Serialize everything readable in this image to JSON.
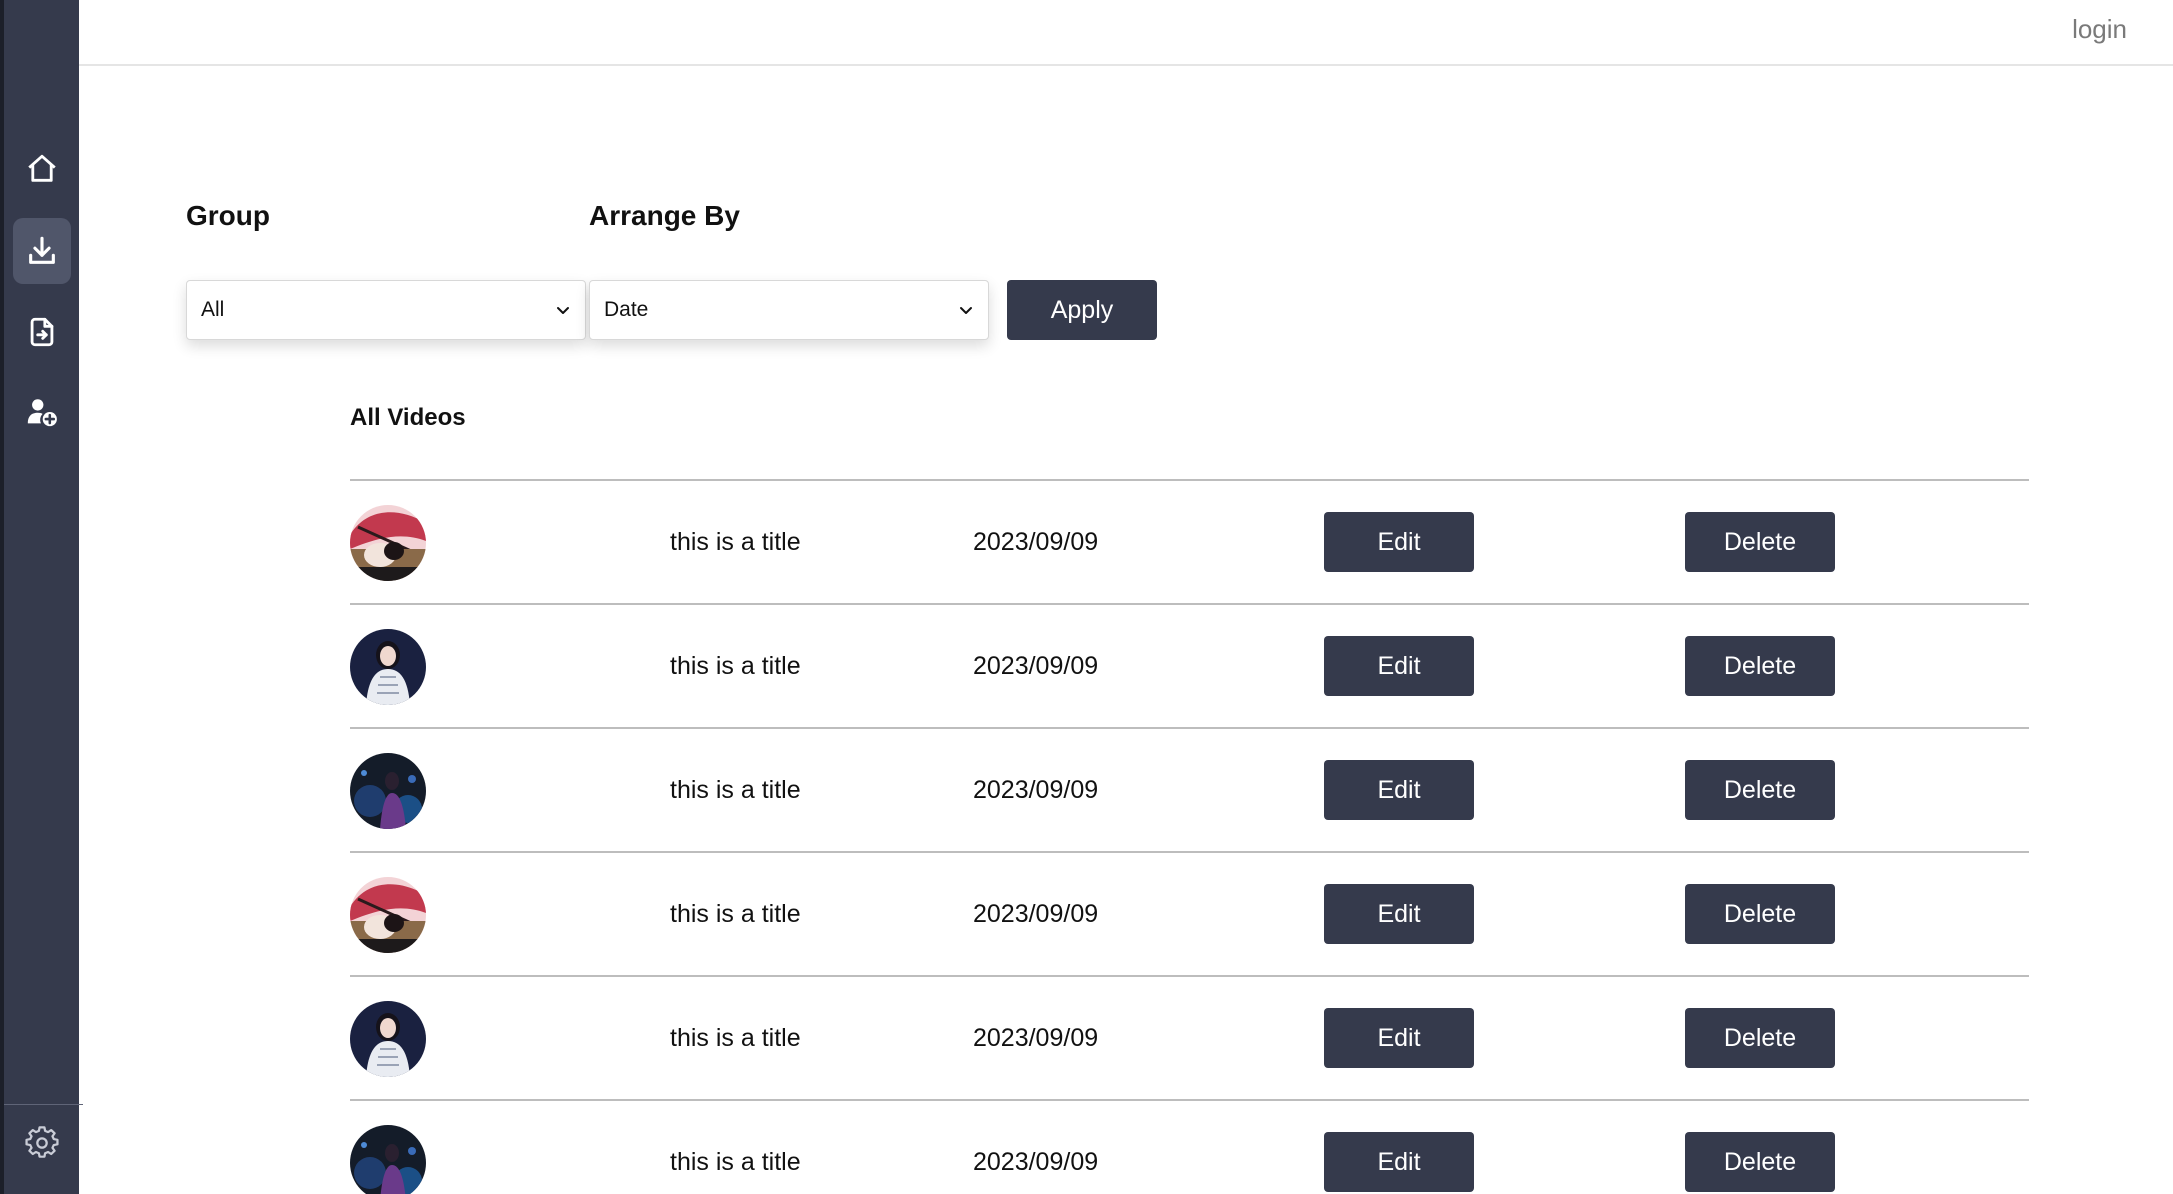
{
  "topbar": {
    "login_label": "login"
  },
  "sidebar": {
    "items": [
      {
        "icon": "home-icon"
      },
      {
        "icon": "download-icon",
        "active": true
      },
      {
        "icon": "file-import-icon"
      },
      {
        "icon": "add-user-icon"
      }
    ],
    "footer_icon": "gear-icon"
  },
  "filters": {
    "group_label": "Group",
    "group_value": "All",
    "arrange_label": "Arrange By",
    "arrange_value": "Date",
    "apply_label": "Apply"
  },
  "videos": {
    "heading": "All Videos",
    "edit_label": "Edit",
    "delete_label": "Delete",
    "rows": [
      {
        "title": "this is a title",
        "date": "2023/09/09",
        "thumb": "pink-umbrella"
      },
      {
        "title": "this is a title",
        "date": "2023/09/09",
        "thumb": "white-dress"
      },
      {
        "title": "this is a title",
        "date": "2023/09/09",
        "thumb": "blue-night"
      },
      {
        "title": "this is a title",
        "date": "2023/09/09",
        "thumb": "pink-umbrella"
      },
      {
        "title": "this is a title",
        "date": "2023/09/09",
        "thumb": "white-dress"
      },
      {
        "title": "this is a title",
        "date": "2023/09/09",
        "thumb": "blue-night"
      }
    ]
  },
  "colors": {
    "sidebar": "#353a4c",
    "button": "#353a4c",
    "active_nav": "#50566a",
    "divider": "#bdbdbd"
  }
}
